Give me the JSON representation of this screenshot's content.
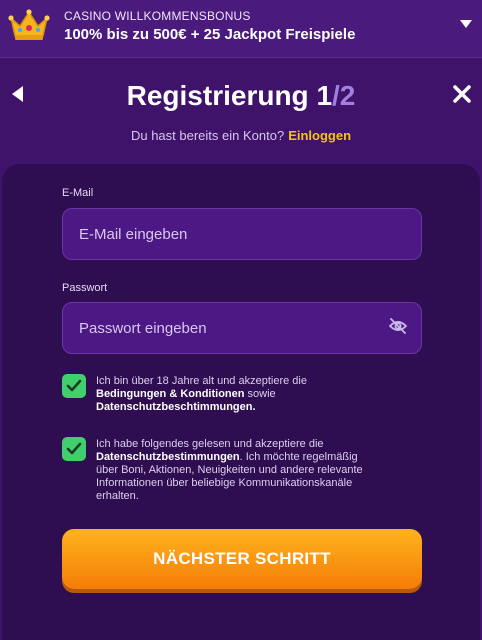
{
  "promo": {
    "label": "CASINO WILLKOMMENSBONUS",
    "offer": "100% bis zu 500€ + 25 Jackpot Freispiele",
    "icon": "crown-icon",
    "dropdown_icon": "chevron-down-icon"
  },
  "header": {
    "title": "Registrierung",
    "step_current": "1",
    "step_total": "/2",
    "back_icon": "back-arrow-icon",
    "close_icon": "close-icon"
  },
  "login_prompt": {
    "text": "Du hast bereits ein Konto?",
    "link": "Einloggen"
  },
  "form": {
    "email": {
      "label": "E-Mail",
      "placeholder": "E-Mail eingeben",
      "value": ""
    },
    "password": {
      "label": "Passwort",
      "placeholder": "Passwort eingeben",
      "value": "",
      "toggle_icon": "eye-off-icon"
    }
  },
  "consents": [
    {
      "checked": true,
      "text_1": "Ich bin über 18 Jahre alt und akzeptiere die",
      "link_1": "Bedingungen & Konditionen",
      "text_2": "sowie",
      "link_2": "Datenschutzbeschtimmungen."
    },
    {
      "checked": true,
      "text_1": "Ich habe folgendes gelesen und akzeptiere die",
      "link_1": "Datenschutzbestimmungen",
      "text_2": ". Ich möchte regelmäßig über Boni, Aktionen, Neuigkeiten und andere relevante Informationen über beliebige Kommunikationskanäle erhalten."
    }
  ],
  "submit": {
    "label": "NÄCHSTER SCHRITT"
  },
  "colors": {
    "background": "#3f136a",
    "panel": "#2e0d50",
    "input": "#4c1883",
    "accent_link": "#f7c117",
    "checkbox": "#3fcf6d",
    "button_top": "#ffb31e",
    "button_bottom": "#f57d07"
  }
}
